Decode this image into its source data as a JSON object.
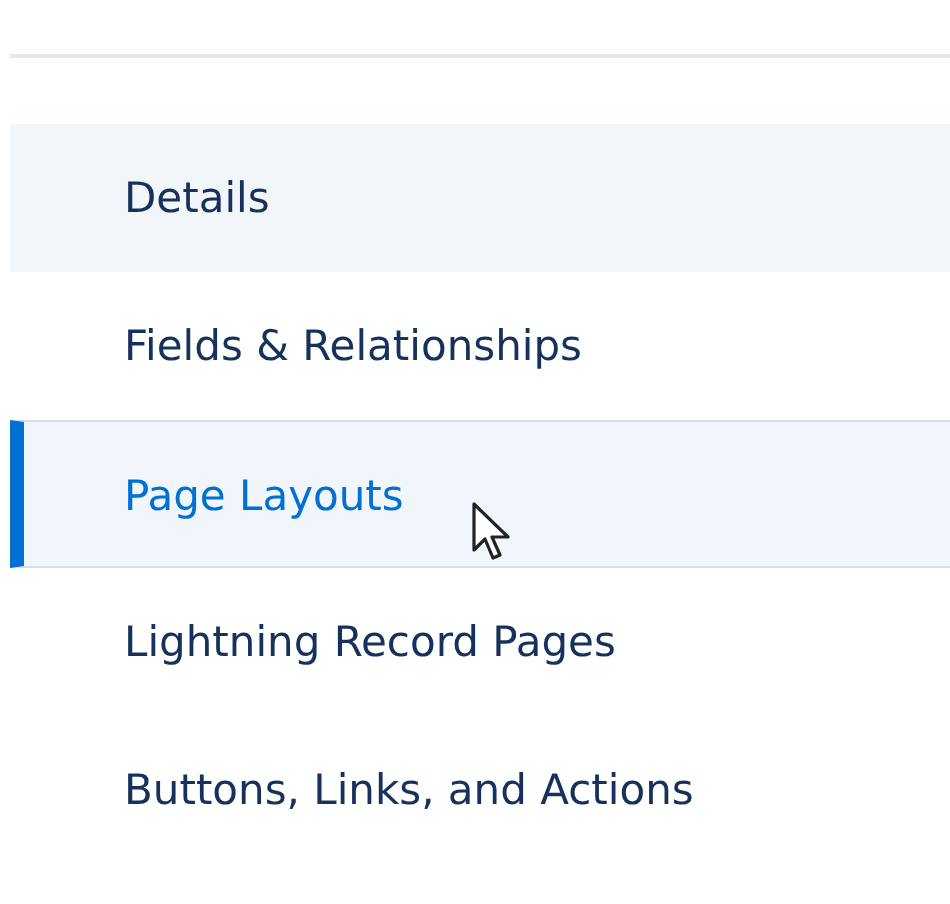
{
  "nav_items": [
    {
      "label": "Details",
      "selected": false,
      "shaded": true
    },
    {
      "label": "Fields & Relationships",
      "selected": false,
      "shaded": false
    },
    {
      "label": "Page Layouts",
      "selected": true,
      "shaded": false
    },
    {
      "label": "Lightning Record Pages",
      "selected": false,
      "shaded": false
    },
    {
      "label": "Buttons, Links, and Actions",
      "selected": false,
      "shaded": false
    }
  ]
}
